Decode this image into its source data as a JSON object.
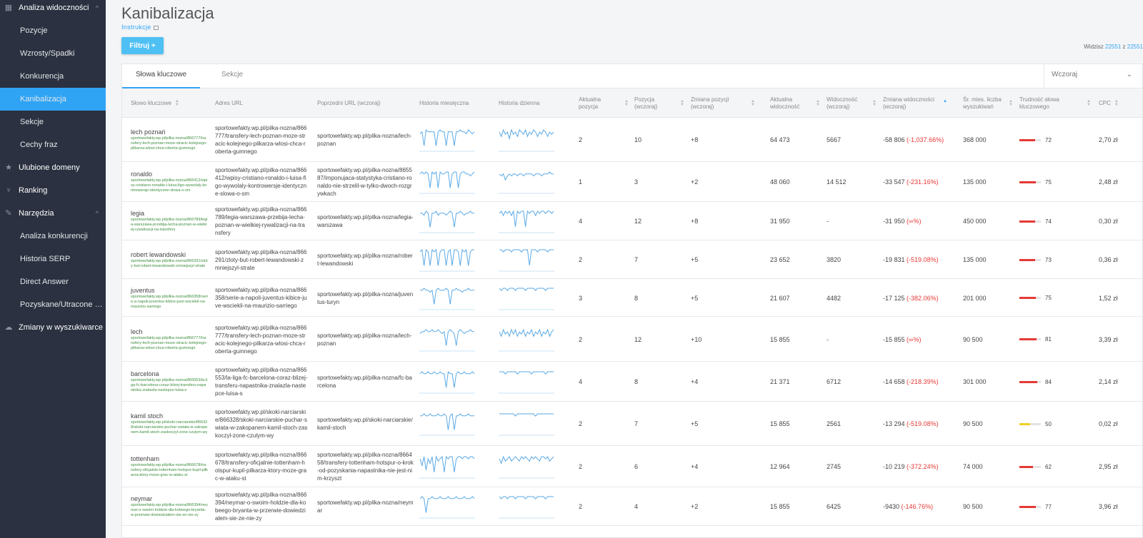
{
  "sidebar": {
    "items": [
      {
        "label": "Analiza widoczności",
        "type": "top",
        "icon": "grid-icon",
        "chevron": "^"
      },
      {
        "label": "Pozycje",
        "type": "sub"
      },
      {
        "label": "Wzrosty/Spadki",
        "type": "sub"
      },
      {
        "label": "Konkurencja",
        "type": "sub"
      },
      {
        "label": "Kanibalizacja",
        "type": "sub",
        "active": true
      },
      {
        "label": "Sekcje",
        "type": "sub"
      },
      {
        "label": "Cechy fraz",
        "type": "sub"
      },
      {
        "label": "Ulubione domeny",
        "type": "top",
        "icon": "star-icon"
      },
      {
        "label": "Ranking",
        "type": "top",
        "icon": "trophy-icon"
      },
      {
        "label": "Narzędzia",
        "type": "top",
        "icon": "wrench-icon",
        "chevron": "^"
      },
      {
        "label": "Analiza konkurencji",
        "type": "sub"
      },
      {
        "label": "Historia SERP",
        "type": "sub"
      },
      {
        "label": "Direct Answer",
        "type": "sub"
      },
      {
        "label": "Pozyskane/Utracone sło...",
        "type": "sub"
      },
      {
        "label": "Zmiany w wyszukiwarce",
        "type": "top",
        "icon": "cloud-icon"
      }
    ]
  },
  "header": {
    "title": "Kanibalizacja",
    "instructions": "Instrukcje",
    "filter_button": "Filtruj +",
    "count_prefix": "Widzisz",
    "count_shown": "22551",
    "count_sep": "z",
    "count_total": "22551"
  },
  "tabs": [
    {
      "label": "Słowa kluczowe",
      "active": true
    },
    {
      "label": "Sekcje",
      "active": false
    }
  ],
  "date_select": {
    "value": "Wczoraj"
  },
  "columns": [
    {
      "key": "keyword",
      "label": "Słowo kluczowe",
      "sortable": true
    },
    {
      "key": "url",
      "label": "Adres URL",
      "sortable": false
    },
    {
      "key": "prev_url",
      "label": "Poprzedni URL (wczoraj)",
      "sortable": false
    },
    {
      "key": "monthly",
      "label": "Historia miesięczna",
      "sortable": false
    },
    {
      "key": "daily",
      "label": "Historia dzienna",
      "sortable": false
    },
    {
      "key": "pos",
      "label": "Aktualna pozycja",
      "sortable": true
    },
    {
      "key": "pos_y",
      "label": "Pozycja (wczoraj)",
      "sortable": true
    },
    {
      "key": "pos_change",
      "label": "Zmiana pozycji (wczoraj)",
      "sortable": true
    },
    {
      "key": "vis",
      "label": "Aktualna widoczność",
      "sortable": true
    },
    {
      "key": "vis_y",
      "label": "Widoczność (wczoraj)",
      "sortable": true
    },
    {
      "key": "vis_change",
      "label": "Zmiana widoczności (wczoraj)",
      "sortable": true,
      "active": true
    },
    {
      "key": "volume",
      "label": "Śr. mies. liczba wyszukiwań",
      "sortable": true
    },
    {
      "key": "difficulty",
      "label": "Trudność słowa kluczowego",
      "sortable": true
    },
    {
      "key": "cpc",
      "label": "CPC",
      "sortable": true
    }
  ],
  "rows": [
    {
      "keyword": "lech poznań",
      "kw_url": "sportowefakty.wp.pl/pilka-nozna/866777/transfery-lech-poznan-moze-stracic-kolejnego-pilkarza-wlosi-chca-roberta-gumnego",
      "url": "sportowefakty.wp.pl/pilka-nozna/866777/transfery-lech-poznan-moze-stracic-kolejnego-pilkarza-wlosi-chca-roberta-gumnego",
      "prev_url": "sportowefakty.wp.pl/pilka-nozna/lech-poznan",
      "monthly": [
        8,
        9,
        2,
        10,
        9,
        9,
        9,
        9,
        2,
        9,
        10,
        9,
        9,
        2,
        9,
        9,
        9,
        2,
        9,
        9,
        10,
        9,
        9,
        8,
        10,
        9,
        8,
        9
      ],
      "daily": [
        8,
        6,
        9,
        7,
        8,
        5,
        9,
        7,
        8,
        6,
        9,
        8,
        7,
        9,
        6,
        8,
        7,
        9,
        8,
        6,
        8,
        7,
        9,
        8,
        6,
        8,
        7,
        8
      ],
      "pos": "2",
      "pos_y": "10",
      "pos_change": "+8",
      "vis": "64 473",
      "vis_y": "5667",
      "vis_change": "-58 806",
      "vis_change_pct": "(-1,037.66%)",
      "volume": "368 000",
      "difficulty": 72,
      "cpc": "2,70 zł"
    },
    {
      "keyword": "ronaldo",
      "kw_url": "sportowefakty.wp.pl/pilka-nozna/866412/wpisy-cristiano-ronaldo-i-luisa-figo-wywolaly-kontrowersje-identyczne-slowa-o-sm",
      "url": "sportowefakty.wp.pl/pilka-nozna/866412/wpisy-cristiano-ronaldo-i-luisa-figo-wywolaly-kontrowersje-identyczne-slowa-o-sm",
      "prev_url": "sportowefakty.wp.pl/pilka-nozna/865587/imponujaca-statystyka-cristiano-ronaldo-nie-strzelil-w-tylko-dwoch-rozgrywkach",
      "monthly": [
        9,
        10,
        9,
        10,
        9,
        2,
        10,
        9,
        10,
        2,
        10,
        9,
        9,
        10,
        10,
        2,
        9,
        10,
        10,
        2,
        9,
        10,
        10,
        9,
        9,
        8,
        9,
        10
      ],
      "daily": [
        9,
        8,
        9,
        6,
        8,
        9,
        8,
        9,
        9,
        8,
        9,
        9,
        8,
        9,
        9,
        9,
        9,
        8,
        9,
        9,
        9,
        8,
        9,
        9,
        9,
        10,
        9,
        9
      ],
      "pos": "1",
      "pos_y": "3",
      "pos_change": "+2",
      "vis": "48 060",
      "vis_y": "14 512",
      "vis_change": "-33 547",
      "vis_change_pct": "(-231.16%)",
      "volume": "135 000",
      "difficulty": 75,
      "cpc": "2,48 zł"
    },
    {
      "keyword": "legia",
      "kw_url": "sportowefakty.wp.pl/pilka-nozna/866789/legia-warszawa-przebija-lecha-poznan-w-wielkiej-rywalizacji-na-transfery",
      "url": "sportowefakty.wp.pl/pilka-nozna/866789/legia-warszawa-przebija-lecha-poznan-w-wielkiej-rywalizacji-na-transfery",
      "prev_url": "sportowefakty.wp.pl/pilka-nozna/legia-warszawa",
      "monthly": [
        9,
        9,
        8,
        10,
        9,
        2,
        9,
        9,
        10,
        8,
        9,
        9,
        9,
        8,
        9,
        10,
        9,
        2,
        9,
        9,
        10,
        9,
        8,
        9,
        9,
        10,
        9,
        9
      ],
      "daily": [
        8,
        9,
        7,
        9,
        8,
        9,
        7,
        9,
        2,
        9,
        8,
        9,
        9,
        2,
        9,
        8,
        9,
        9,
        7,
        9,
        8,
        9,
        9,
        8,
        9,
        9,
        8,
        9
      ],
      "pos": "4",
      "pos_y": "12",
      "pos_change": "+8",
      "vis": "31 950",
      "vis_y": "-",
      "vis_change": "-31 950",
      "vis_change_pct": "(∞%)",
      "volume": "450 000",
      "difficulty": 74,
      "cpc": "0,30 zł"
    },
    {
      "keyword": "robert lewandowski",
      "kw_url": "sportowefakty.wp.pl/pilka-nozna/866291/zloty-but-robert-lewandowski-zmniejszyl-strate",
      "url": "sportowefakty.wp.pl/pilka-nozna/866291/zloty-but-robert-lewandowski-zmniejszyl-strate",
      "prev_url": "sportowefakty.wp.pl/pilka-nozna/robert-lewandowski",
      "monthly": [
        9,
        10,
        2,
        10,
        9,
        2,
        10,
        9,
        10,
        2,
        9,
        10,
        10,
        2,
        9,
        10,
        2,
        10,
        10,
        9,
        2,
        10,
        9,
        10,
        2,
        9,
        10,
        10
      ],
      "daily": [
        9,
        9,
        8,
        9,
        9,
        9,
        8,
        9,
        9,
        9,
        9,
        8,
        9,
        9,
        9,
        2,
        9,
        9,
        9,
        8,
        9,
        9,
        9,
        9,
        8,
        9,
        9,
        9
      ],
      "pos": "2",
      "pos_y": "7",
      "pos_change": "+5",
      "vis": "23 652",
      "vis_y": "3820",
      "vis_change": "-19 831",
      "vis_change_pct": "(-519.08%)",
      "volume": "135 000",
      "difficulty": 73,
      "cpc": "0,36 zł"
    },
    {
      "keyword": "juventus",
      "kw_url": "sportowefakty.wp.pl/pilka-nozna/866358/serie-a-napoli-juventus-kibice-juve-wsciekli-na-maurizio-sarriego",
      "url": "sportowefakty.wp.pl/pilka-nozna/866358/serie-a-napoli-juventus-kibice-juve-wsciekli-na-maurizio-sarriego",
      "prev_url": "sportowefakty.wp.pl/pilka-nozna/juventus-turyn",
      "monthly": [
        9,
        9,
        10,
        9,
        9,
        8,
        9,
        2,
        9,
        10,
        9,
        9,
        9,
        10,
        9,
        2,
        9,
        9,
        10,
        9,
        9,
        8,
        9,
        9,
        10,
        9,
        9,
        9
      ],
      "daily": [
        9,
        8,
        9,
        9,
        8,
        9,
        9,
        9,
        8,
        9,
        9,
        9,
        9,
        8,
        9,
        9,
        9,
        9,
        8,
        9,
        9,
        9,
        9,
        8,
        9,
        9,
        9,
        9
      ],
      "pos": "3",
      "pos_y": "8",
      "pos_change": "+5",
      "vis": "21 607",
      "vis_y": "4482",
      "vis_change": "-17 125",
      "vis_change_pct": "(-382.06%)",
      "volume": "201 000",
      "difficulty": 75,
      "cpc": "1,52 zł"
    },
    {
      "keyword": "lech",
      "kw_url": "sportowefakty.wp.pl/pilka-nozna/866777/transfery-lech-poznan-moze-stracic-kolejnego-pilkarza-wlosi-chca-roberta-gumnego",
      "url": "sportowefakty.wp.pl/pilka-nozna/866777/transfery-lech-poznan-moze-stracic-kolejnego-pilkarza-wlosi-chca-roberta-gumnego",
      "prev_url": "sportowefakty.wp.pl/pilka-nozna/lech-poznan",
      "monthly": [
        8,
        9,
        9,
        10,
        9,
        9,
        10,
        9,
        9,
        10,
        9,
        8,
        9,
        2,
        9,
        10,
        9,
        8,
        2,
        9,
        10,
        9,
        8,
        9,
        9,
        10,
        9,
        9
      ],
      "daily": [
        8,
        6,
        9,
        7,
        8,
        6,
        9,
        7,
        9,
        6,
        8,
        7,
        9,
        6,
        8,
        7,
        9,
        6,
        8,
        7,
        9,
        6,
        8,
        7,
        9,
        6,
        8,
        9
      ],
      "pos": "2",
      "pos_y": "12",
      "pos_change": "+10",
      "vis": "15 855",
      "vis_y": "-",
      "vis_change": "-15 855",
      "vis_change_pct": "(∞%)",
      "volume": "90 500",
      "difficulty": 81,
      "cpc": "3,39 zł"
    },
    {
      "keyword": "barcelona",
      "kw_url": "sportowefakty.wp.pl/pilka-nozna/866553/la-liga-fc-barcelona-coraz-blizej-transferu-napastnika-znalazla-nastepce-luisa-s",
      "url": "sportowefakty.wp.pl/pilka-nozna/866553/la-liga-fc-barcelona-coraz-blizej-transferu-napastnika-znalazla-nastepce-luisa-s",
      "prev_url": "sportowefakty.wp.pl/pilka-nozna/fc-barcelona",
      "monthly": [
        9,
        10,
        9,
        9,
        10,
        9,
        9,
        10,
        9,
        9,
        10,
        9,
        9,
        2,
        10,
        9,
        9,
        2,
        9,
        10,
        9,
        9,
        10,
        9,
        9,
        9,
        10,
        9
      ],
      "daily": [
        9,
        9,
        9,
        8,
        9,
        9,
        9,
        9,
        9,
        8,
        9,
        9,
        9,
        9,
        9,
        9,
        8,
        9,
        9,
        9,
        9,
        9,
        9,
        8,
        9,
        9,
        9,
        9
      ],
      "pos": "4",
      "pos_y": "8",
      "pos_change": "+4",
      "vis": "21 371",
      "vis_y": "6712",
      "vis_change": "-14 658",
      "vis_change_pct": "(-218.39%)",
      "volume": "301 000",
      "difficulty": 84,
      "cpc": "2,14 zł"
    },
    {
      "keyword": "kamil stoch",
      "kw_url": "sportowefakty.wp.pl/skoki-narciarskie/866328/skoki-narciarskie-puchar-swiata-w-zakopanem-kamil-stoch-zaskoczyl-zone-czulym-wy",
      "url": "sportowefakty.wp.pl/skoki-narciarskie/866328/skoki-narciarskie-puchar-swiata-w-zakopanem-kamil-stoch-zaskoczyl-zone-czulym-wy",
      "prev_url": "sportowefakty.wp.pl/skoki-narciarskie/kamil-stoch",
      "monthly": [
        9,
        9,
        10,
        9,
        9,
        10,
        9,
        9,
        9,
        10,
        9,
        9,
        10,
        9,
        2,
        9,
        10,
        2,
        9,
        9,
        10,
        9,
        9,
        9,
        10,
        9,
        9,
        9
      ],
      "daily": [
        9,
        9,
        9,
        9,
        9,
        9,
        9,
        9,
        8,
        9,
        9,
        9,
        9,
        9,
        9,
        9,
        9,
        9,
        8,
        9,
        9,
        9,
        9,
        9,
        9,
        9,
        9,
        9
      ],
      "pos": "2",
      "pos_y": "7",
      "pos_change": "+5",
      "vis": "15 855",
      "vis_y": "2561",
      "vis_change": "-13 294",
      "vis_change_pct": "(-519.08%)",
      "volume": "90 500",
      "difficulty": 50,
      "cpc": "0,02 zł"
    },
    {
      "keyword": "tottenham",
      "kw_url": "sportowefakty.wp.pl/pilka-nozna/866678/transfery-oficjalnie-tottenham-hotspur-kupil-pilkarza-ktory-moze-grac-w-ataku-st",
      "url": "sportowefakty.wp.pl/pilka-nozna/866678/transfery-oficjalnie-tottenham-hotspur-kupil-pilkarza-ktory-moze-grac-w-ataku-st",
      "prev_url": "sportowefakty.wp.pl/pilka-nozna/866458/transfery-tottenham-hotspur-o-krok-od-pozyskania-napastnika-nie-jest-nim-krzyszt",
      "monthly": [
        8,
        5,
        9,
        3,
        8,
        6,
        9,
        2,
        9,
        7,
        8,
        9,
        2,
        9,
        8,
        9,
        9,
        2,
        8,
        9,
        9,
        8,
        9,
        9,
        8,
        9,
        9,
        8
      ],
      "daily": [
        8,
        6,
        9,
        7,
        8,
        9,
        7,
        8,
        9,
        8,
        7,
        9,
        8,
        9,
        8,
        7,
        9,
        8,
        9,
        8,
        7,
        9,
        9,
        8,
        9,
        7,
        8,
        9
      ],
      "pos": "2",
      "pos_y": "6",
      "pos_change": "+4",
      "vis": "12 964",
      "vis_y": "2745",
      "vis_change": "-10 219",
      "vis_change_pct": "(-372.24%)",
      "volume": "74 000",
      "difficulty": 62,
      "cpc": "2,95 zł"
    },
    {
      "keyword": "neymar",
      "kw_url": "sportowefakty.wp.pl/pilka-nozna/866394/neymar-o-swoim-holdzie-dla-kobeego-bryanta-w-przerwie-dowiedzialem-sie-ze-nie-zy",
      "url": "sportowefakty.wp.pl/pilka-nozna/866394/neymar-o-swoim-holdzie-dla-kobeego-bryanta-w-przerwie-dowiedzialem-sie-ze-nie-zy",
      "prev_url": "sportowefakty.wp.pl/pilka-nozna/neymar",
      "monthly": [
        9,
        10,
        9,
        2,
        9,
        9,
        10,
        9,
        9,
        9,
        10,
        9,
        9,
        9,
        10,
        9,
        9,
        9,
        10,
        9,
        9,
        9,
        10,
        9,
        9,
        9,
        10,
        9
      ],
      "daily": [
        9,
        8,
        9,
        9,
        8,
        9,
        9,
        9,
        8,
        9,
        9,
        9,
        9,
        8,
        9,
        9,
        9,
        9,
        8,
        9,
        9,
        9,
        9,
        8,
        9,
        9,
        9,
        9
      ],
      "pos": "2",
      "pos_y": "4",
      "pos_change": "+2",
      "vis": "15 855",
      "vis_y": "6425",
      "vis_change": "-9430",
      "vis_change_pct": "(-146.76%)",
      "volume": "90 500",
      "difficulty": 77,
      "cpc": "3,96 zł"
    }
  ],
  "colors": {
    "accent": "#2fa4f5",
    "negative": "#e53935",
    "spark": "#5aa9e6",
    "difficulty_high": "#e53935",
    "difficulty_mid": "#f2d027",
    "keyword_url": "#3d8f3d"
  }
}
